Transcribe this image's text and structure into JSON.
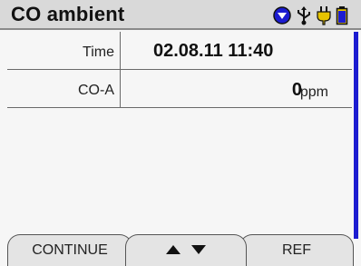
{
  "header": {
    "title": "CO ambient",
    "icons": [
      "gas-sensor-icon",
      "usb-connection-icon",
      "mains-plug-icon",
      "battery-icon"
    ]
  },
  "readings": [
    {
      "label": "Time",
      "value": "02.08.11 11:40"
    },
    {
      "label": "CO-A",
      "value": "0",
      "unit": "ppm"
    }
  ],
  "softkeys": {
    "left": "CONTINUE",
    "middle_icons": [
      "arrow-up-icon",
      "arrow-down-icon"
    ],
    "right": "REF"
  },
  "colors": {
    "accent": "#1c1cd0",
    "status_yellow": "#e6c400",
    "title_bg": "#d9d9d9"
  }
}
